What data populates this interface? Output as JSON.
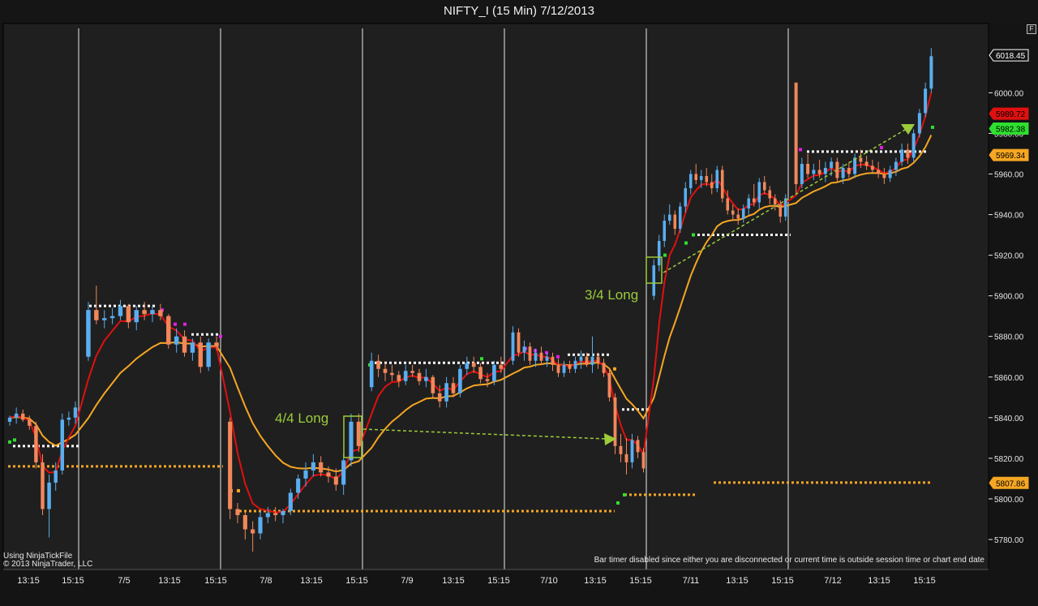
{
  "window": {
    "title": "NIFTY_I (15 Min)  7/12/2013",
    "f_button": "F"
  },
  "status": {
    "source": "Using NinjaTickFile",
    "copyright": "© 2013 NinjaTrader, LLC",
    "bar_timer": "Bar timer disabled since either you are disconnected or current time is outside session time or chart end date"
  },
  "colors": {
    "background": "#141414",
    "plot_bg": "#1f1f1f",
    "up_candle": "#5aaef0",
    "down_candle": "#f2875a",
    "fast_ma": "#e01010",
    "slow_ma": "#f5a623",
    "annotation": "#9bcc3a",
    "stop_level": "#f5a623",
    "target_level": "#ffffff",
    "trail_magenta": "#e020e0",
    "trail_green": "#2ee02e"
  },
  "chart_data": {
    "type": "candlestick",
    "title": "NIFTY_I (15 Min)  7/12/2013",
    "xlabel": "",
    "ylabel": "",
    "ylim": [
      5770,
      6030
    ],
    "y_ticks": [
      5780,
      5800,
      5820,
      5840,
      5860,
      5880,
      5900,
      5920,
      5940,
      5960,
      5980,
      6000
    ],
    "y_tick_labels": [
      "5780.00",
      "5800.00",
      "5820.00",
      "5840.00",
      "5860.00",
      "5880.00",
      "5900.00",
      "5920.00",
      "5940.00",
      "5960.00",
      "5980.00",
      "6000.00"
    ],
    "grid": "vertical session separators only",
    "sessions": [
      {
        "x_labels": [
          "13:15",
          "15:15"
        ],
        "candles": [
          [
            5838,
            5841,
            5836,
            5840
          ],
          [
            5840,
            5845,
            5837,
            5842
          ],
          [
            5842,
            5844,
            5838,
            5839
          ],
          [
            5839,
            5841,
            5834,
            5836
          ],
          [
            5836,
            5838,
            5815,
            5818
          ],
          [
            5818,
            5822,
            5792,
            5795
          ],
          [
            5795,
            5812,
            5781,
            5808
          ],
          [
            5808,
            5818,
            5804,
            5814
          ],
          [
            5814,
            5842,
            5812,
            5839
          ],
          [
            5839,
            5843,
            5836,
            5840
          ],
          [
            5840,
            5848,
            5837,
            5845
          ]
        ]
      },
      {
        "date": "7/5",
        "x_labels": [
          "13:15",
          "15:15"
        ],
        "candles": [
          [
            5870,
            5897,
            5868,
            5893
          ],
          [
            5893,
            5905,
            5886,
            5888
          ],
          [
            5888,
            5893,
            5884,
            5889
          ],
          [
            5889,
            5894,
            5886,
            5890
          ],
          [
            5890,
            5898,
            5888,
            5895
          ],
          [
            5895,
            5896,
            5884,
            5887
          ],
          [
            5887,
            5895,
            5883,
            5893
          ],
          [
            5893,
            5897,
            5888,
            5891
          ],
          [
            5891,
            5895,
            5887,
            5893
          ],
          [
            5893,
            5896,
            5888,
            5890
          ],
          [
            5890,
            5891,
            5874,
            5876
          ],
          [
            5876,
            5884,
            5872,
            5880
          ],
          [
            5880,
            5883,
            5870,
            5872
          ],
          [
            5872,
            5879,
            5868,
            5877
          ],
          [
            5877,
            5880,
            5862,
            5865
          ],
          [
            5865,
            5879,
            5863,
            5877
          ],
          [
            5877,
            5880,
            5873,
            5875
          ]
        ]
      },
      {
        "date": "7/8",
        "x_labels": [
          "13:15",
          "15:15"
        ],
        "candles": [
          [
            5838,
            5840,
            5790,
            5795
          ],
          [
            5795,
            5798,
            5788,
            5792
          ],
          [
            5792,
            5794,
            5780,
            5785
          ],
          [
            5785,
            5789,
            5774,
            5783
          ],
          [
            5783,
            5794,
            5780,
            5791
          ],
          [
            5791,
            5796,
            5788,
            5793
          ],
          [
            5793,
            5796,
            5789,
            5792
          ],
          [
            5792,
            5795,
            5788,
            5794
          ],
          [
            5794,
            5805,
            5792,
            5803
          ],
          [
            5803,
            5812,
            5800,
            5810
          ],
          [
            5810,
            5818,
            5806,
            5814
          ],
          [
            5814,
            5822,
            5811,
            5818
          ],
          [
            5818,
            5821,
            5811,
            5813
          ],
          [
            5813,
            5816,
            5808,
            5811
          ],
          [
            5811,
            5815,
            5804,
            5807
          ],
          [
            5807,
            5822,
            5802,
            5819
          ],
          [
            5819,
            5842,
            5816,
            5838
          ],
          [
            5838,
            5842,
            5823,
            5826
          ]
        ]
      },
      {
        "date": "7/9",
        "x_labels": [
          "13:15",
          "15:15"
        ],
        "candles": [
          [
            5855,
            5872,
            5853,
            5868
          ],
          [
            5868,
            5871,
            5860,
            5864
          ],
          [
            5864,
            5867,
            5858,
            5862
          ],
          [
            5862,
            5866,
            5858,
            5861
          ],
          [
            5861,
            5863,
            5855,
            5858
          ],
          [
            5858,
            5866,
            5856,
            5863
          ],
          [
            5863,
            5866,
            5860,
            5862
          ],
          [
            5862,
            5864,
            5856,
            5858
          ],
          [
            5858,
            5864,
            5855,
            5860
          ],
          [
            5860,
            5861,
            5850,
            5852
          ],
          [
            5852,
            5856,
            5845,
            5848
          ],
          [
            5848,
            5860,
            5845,
            5857
          ],
          [
            5857,
            5860,
            5850,
            5852
          ],
          [
            5852,
            5866,
            5850,
            5864
          ],
          [
            5864,
            5870,
            5861,
            5867
          ],
          [
            5867,
            5870,
            5862,
            5865
          ],
          [
            5865,
            5867,
            5857,
            5859
          ],
          [
            5859,
            5862,
            5855,
            5858
          ],
          [
            5858,
            5868,
            5856,
            5866
          ],
          [
            5866,
            5870,
            5862,
            5864
          ]
        ]
      },
      {
        "date": "7/10",
        "x_labels": [
          "13:15",
          "15:15"
        ],
        "candles": [
          [
            5868,
            5885,
            5866,
            5882
          ],
          [
            5882,
            5884,
            5870,
            5872
          ],
          [
            5872,
            5878,
            5868,
            5875
          ],
          [
            5875,
            5877,
            5866,
            5868
          ],
          [
            5868,
            5874,
            5865,
            5872
          ],
          [
            5872,
            5875,
            5866,
            5868
          ],
          [
            5868,
            5872,
            5865,
            5870
          ],
          [
            5870,
            5872,
            5863,
            5866
          ],
          [
            5866,
            5869,
            5860,
            5862
          ],
          [
            5862,
            5868,
            5860,
            5866
          ],
          [
            5866,
            5868,
            5862,
            5864
          ],
          [
            5864,
            5870,
            5862,
            5868
          ],
          [
            5868,
            5873,
            5864,
            5870
          ],
          [
            5870,
            5872,
            5865,
            5866
          ],
          [
            5866,
            5880,
            5862,
            5870
          ],
          [
            5870,
            5872,
            5864,
            5867
          ],
          [
            5867,
            5869,
            5860,
            5862
          ],
          [
            5862,
            5864,
            5848,
            5850
          ],
          [
            5850,
            5852,
            5822,
            5826
          ],
          [
            5826,
            5832,
            5818,
            5822
          ],
          [
            5822,
            5830,
            5812,
            5818
          ],
          [
            5818,
            5832,
            5815,
            5829
          ],
          [
            5829,
            5831,
            5820,
            5823
          ],
          [
            5823,
            5825,
            5813,
            5815
          ]
        ]
      },
      {
        "date": "7/11",
        "x_labels": [
          "13:15",
          "15:15"
        ],
        "candles": [
          [
            5900,
            5918,
            5898,
            5915
          ],
          [
            5915,
            5930,
            5912,
            5927
          ],
          [
            5927,
            5940,
            5924,
            5937
          ],
          [
            5937,
            5945,
            5935,
            5940
          ],
          [
            5940,
            5942,
            5930,
            5933
          ],
          [
            5933,
            5946,
            5931,
            5944
          ],
          [
            5944,
            5956,
            5941,
            5953
          ],
          [
            5953,
            5962,
            5950,
            5960
          ],
          [
            5960,
            5965,
            5955,
            5957
          ],
          [
            5957,
            5962,
            5953,
            5959
          ],
          [
            5959,
            5963,
            5954,
            5956
          ],
          [
            5956,
            5960,
            5950,
            5953
          ],
          [
            5953,
            5964,
            5951,
            5962
          ],
          [
            5962,
            5964,
            5946,
            5948
          ],
          [
            5948,
            5952,
            5940,
            5942
          ],
          [
            5942,
            5945,
            5937,
            5940
          ],
          [
            5940,
            5943,
            5935,
            5938
          ],
          [
            5938,
            5945,
            5936,
            5943
          ],
          [
            5943,
            5950,
            5940,
            5948
          ],
          [
            5948,
            5955,
            5944,
            5946
          ],
          [
            5946,
            5958,
            5943,
            5956
          ],
          [
            5956,
            5959,
            5950,
            5952
          ],
          [
            5952,
            5954,
            5945,
            5948
          ],
          [
            5948,
            5950,
            5942,
            5945
          ],
          [
            5945,
            5947,
            5936,
            5939
          ],
          [
            5939,
            5950,
            5937,
            5948
          ]
        ]
      },
      {
        "date": "7/12",
        "x_labels": [
          "13:15",
          "15:15"
        ],
        "candles": [
          [
            6005,
            6005,
            5950,
            5955
          ],
          [
            5955,
            5968,
            5953,
            5965
          ],
          [
            5965,
            5970,
            5958,
            5960
          ],
          [
            5960,
            5965,
            5957,
            5962
          ],
          [
            5962,
            5967,
            5958,
            5960
          ],
          [
            5960,
            5966,
            5956,
            5963
          ],
          [
            5963,
            5968,
            5959,
            5966
          ],
          [
            5966,
            5968,
            5956,
            5958
          ],
          [
            5958,
            5965,
            5955,
            5963
          ],
          [
            5963,
            5966,
            5958,
            5960
          ],
          [
            5960,
            5970,
            5958,
            5968
          ],
          [
            5968,
            5972,
            5963,
            5966
          ],
          [
            5966,
            5969,
            5962,
            5964
          ],
          [
            5964,
            5967,
            5960,
            5962
          ],
          [
            5962,
            5966,
            5958,
            5960
          ],
          [
            5960,
            5963,
            5955,
            5958
          ],
          [
            5958,
            5964,
            5956,
            5962
          ],
          [
            5962,
            5968,
            5959,
            5966
          ],
          [
            5966,
            5975,
            5964,
            5972
          ],
          [
            5972,
            5975,
            5965,
            5968
          ],
          [
            5968,
            5982,
            5966,
            5980
          ],
          [
            5980,
            5992,
            5978,
            5990
          ],
          [
            5990,
            6005,
            5988,
            6002
          ],
          [
            6002,
            6022,
            6000,
            6018
          ]
        ]
      }
    ],
    "price_markers": [
      {
        "value": 6018.45,
        "label": "6018.45",
        "color": "#141414",
        "text_color": "#ffffff",
        "border": "#ffffff"
      },
      {
        "value": 5989.72,
        "label": "5989.72",
        "color": "#e01010",
        "text_color": "#000000"
      },
      {
        "value": 5982.38,
        "label": "5982.38",
        "color": "#2ee02e",
        "text_color": "#000000"
      },
      {
        "value": 5969.34,
        "label": "5969.34",
        "color": "#f5a623",
        "text_color": "#000000"
      },
      {
        "value": 5807.86,
        "label": "5807.86",
        "color": "#f5a623",
        "text_color": "#000000"
      }
    ],
    "annotations": [
      {
        "text": "4/4 Long",
        "color": "#9bcc3a"
      },
      {
        "text": "3/4 Long",
        "color": "#9bcc3a"
      }
    ]
  }
}
